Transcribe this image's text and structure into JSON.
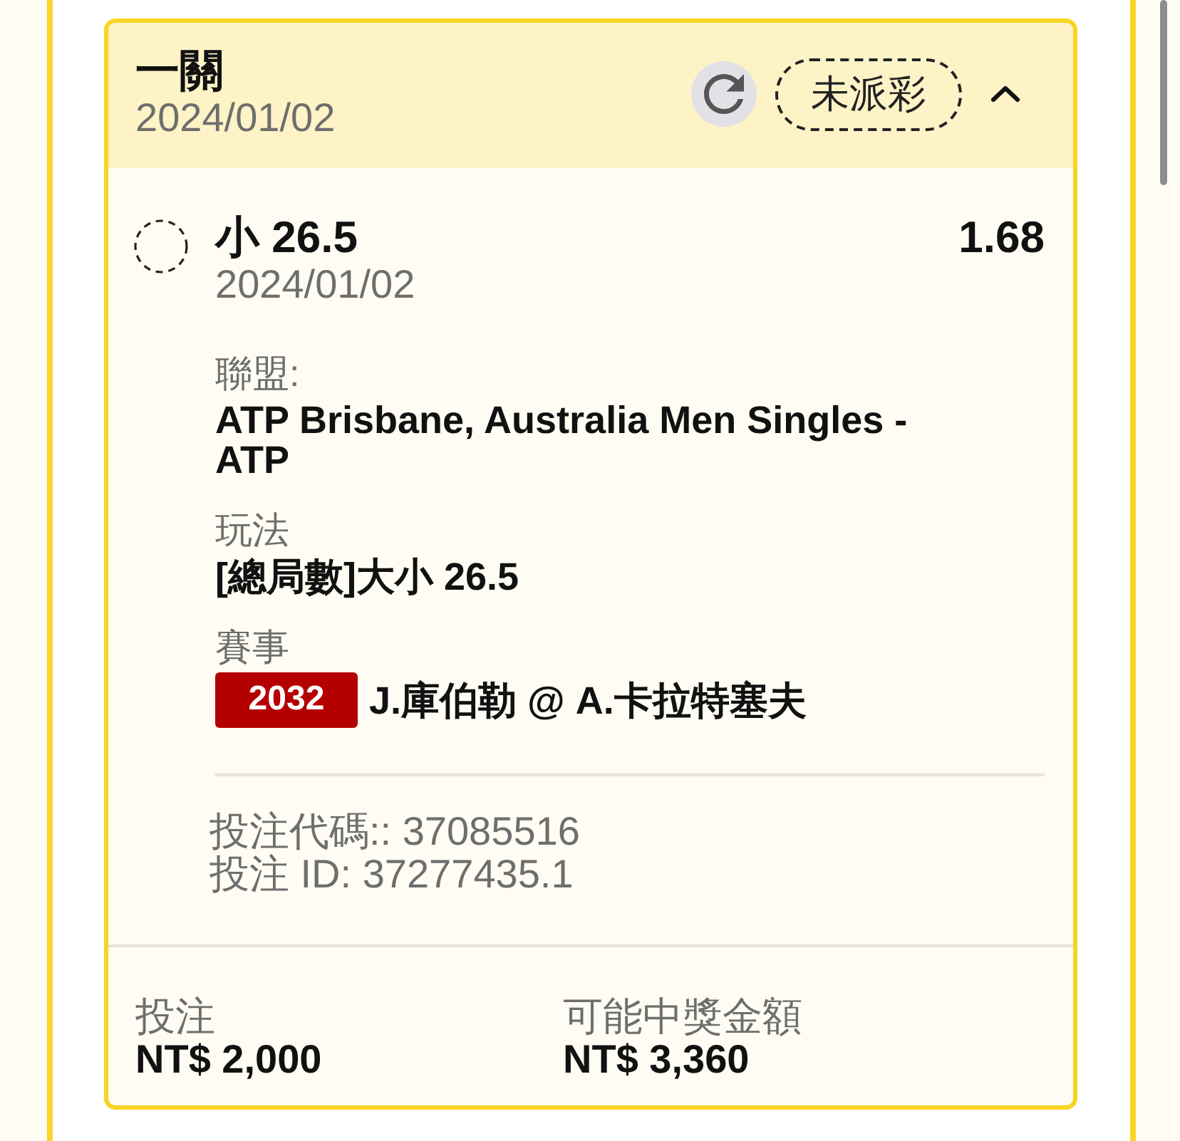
{
  "bet_card": {
    "title": "一關",
    "date": "2024/01/02",
    "status": "未派彩",
    "expanded": true,
    "selection": {
      "name": "小 26.5",
      "date": "2024/01/02",
      "odds": "1.68"
    },
    "details": [
      {
        "label": "聯盟:",
        "value": "ATP Brisbane, Australia Men Singles - ATP"
      },
      {
        "label": "玩法",
        "value": "[總局數]大小 26.5"
      },
      {
        "label": "賽事",
        "event_code": "2032",
        "value": "J.庫伯勒 @ A.卡拉特塞夫"
      }
    ],
    "references": [
      "投注代碼:: 37085516",
      "投注 ID: 37277435.1"
    ],
    "summary": [
      {
        "label": "投注",
        "value": "NT$ 2,000"
      },
      {
        "label": "可能中獎金額",
        "value": "NT$ 3,360"
      }
    ]
  }
}
